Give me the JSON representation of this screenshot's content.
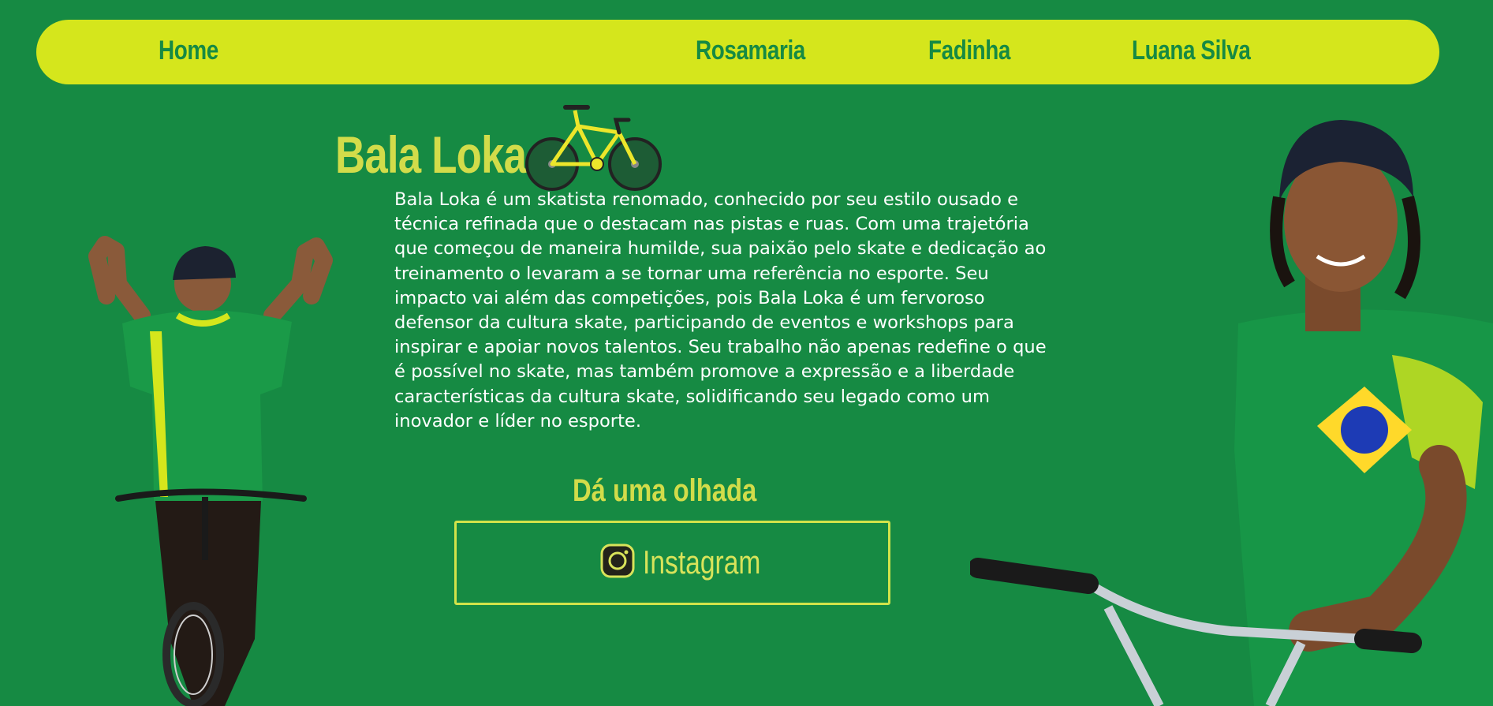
{
  "nav": {
    "items": [
      {
        "label": "Home"
      },
      {
        "label": "Rosamaria"
      },
      {
        "label": "Fadinha"
      },
      {
        "label": "Luana Silva"
      }
    ]
  },
  "hero": {
    "title": "Bala Loka",
    "title_icon": "bicycle-icon",
    "bio": "Bala Loka é um skatista renomado, conhecido por seu estilo ousado e técnica refinada que o destacam nas pistas e ruas. Com uma trajetória que começou de maneira humilde, sua paixão pelo skate e dedicação ao treinamento o levaram a se tornar uma referência no esporte. Seu impacto vai além das competições, pois Bala Loka é um fervoroso defensor da cultura skate, participando de eventos e workshops para inspirar e apoiar novos talentos. Seu trabalho não apenas redefine o que é possível no skate, mas também promove a expressão e a liberdade características da cultura skate, solidificando seu legado como um inovador e líder no esporte."
  },
  "social": {
    "heading": "Dá uma olhada",
    "instagram_label": "Instagram",
    "instagram_icon": "instagram-icon"
  },
  "images": {
    "left_photo": "athlete-celebrating-photo",
    "right_photo": "athlete-smiling-photo"
  },
  "colors": {
    "background": "#168a43",
    "navbar": "#d5e61c",
    "accent": "#d2dc4a",
    "text": "#ffffff"
  }
}
